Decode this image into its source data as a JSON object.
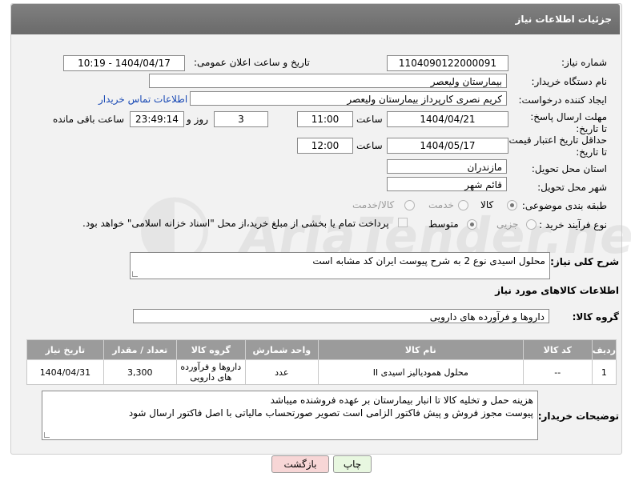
{
  "header": {
    "title": "جزئیات اطلاعات نیاز"
  },
  "fields": {
    "need_number_label": "شماره نیاز:",
    "need_number": "1104090122000091",
    "announce_label": "تاریخ و ساعت اعلان عمومی:",
    "announce_value": "1404/04/17 - 10:19",
    "buyer_org_label": "نام دستگاه خریدار:",
    "buyer_org": "بیمارستان ولیعصر",
    "creator_label": "ایجاد کننده درخواست:",
    "creator": "کریم نصری کارپرداز بیمارستان ولیعصر",
    "contact_link": "اطلاعات تماس خریدار",
    "deadline_label": "مهلت ارسال پاسخ: تا تاریخ:",
    "deadline_date": "1404/04/21",
    "time_label": "ساعت",
    "deadline_time": "11:00",
    "days_value": "3",
    "days_label": "روز و",
    "remaining_time": "23:49:14",
    "remaining_label": "ساعت باقی مانده",
    "min_price_label": "حداقل تاریخ اعتبار قیمت: تا تاریخ:",
    "min_price_date": "1404/05/17",
    "min_price_time": "12:00",
    "province_label": "استان محل تحویل:",
    "province": "مازندران",
    "city_label": "شهر محل تحویل:",
    "city": "قائم شهر",
    "category_label": "طبقه بندی موضوعی:",
    "category_options": [
      "کالا",
      "خدمت",
      "کالا/خدمت"
    ],
    "category_selected": "کالا",
    "process_label": "نوع فرآیند خرید :",
    "process_options": [
      "جزیی",
      "متوسط"
    ],
    "process_selected": "متوسط",
    "payment_note": "پرداخت تمام یا بخشی از مبلغ خرید،از محل \"اسناد خزانه اسلامی\" خواهد بود."
  },
  "description": {
    "label": "شرح کلی نیاز:",
    "text": "محلول اسیدی نوع 2 به شرح پیوست  ایران کد مشابه است"
  },
  "goods": {
    "section_title": "اطلاعات کالاهای مورد نیاز",
    "group_label": "گروه کالا:",
    "group_value": "داروها و فرآورده های دارویی",
    "columns": [
      "ردیف",
      "کد کالا",
      "نام کالا",
      "واحد شمارش",
      "گروه کالا",
      "تعداد / مقدار",
      "تاریخ نیاز"
    ],
    "rows": [
      [
        "1",
        "--",
        "محلول همودیالیز اسیدی II",
        "عدد",
        "داروها و فرآورده های دارویی",
        "3,300",
        "1404/04/31"
      ]
    ]
  },
  "buyer_notes": {
    "label": "توضیحات خریدار:",
    "line1": "هزینه حمل و تخلیه کالا تا انبار بیمارستان بر عهده فروشنده میباشد",
    "line2": "پیوست مجوز فروش و پیش فاکتور الزامی است  تصویر صورتحساب مالیاتی با اصل فاکتور ارسال شود"
  },
  "buttons": {
    "print": "چاپ",
    "back": "بازگشت"
  },
  "watermark": "AriaTender.net",
  "colors": {
    "header": "#747474",
    "link": "#1a4ab5",
    "back_button": "#f7d6d6",
    "print_button": "#e8f7e0"
  }
}
